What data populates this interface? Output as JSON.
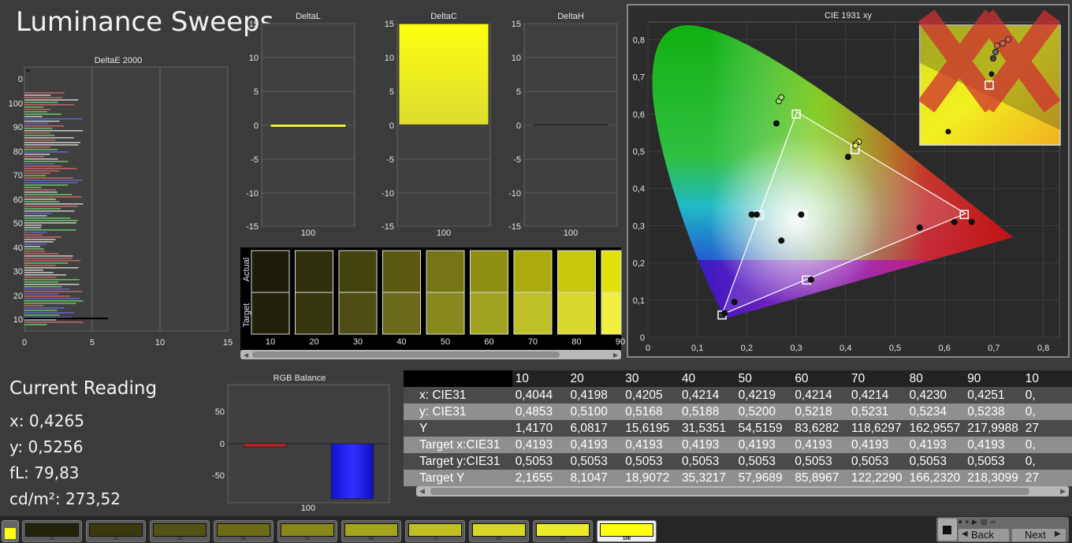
{
  "page_title": "Luminance Sweeps",
  "deltae_chart": {
    "title": "DeltaE 2000",
    "y_ticks": [
      "0",
      "100",
      "90",
      "80",
      "70",
      "60",
      "50",
      "40",
      "30",
      "20",
      "10"
    ],
    "x_ticks": [
      "0",
      "5",
      "10",
      "15"
    ]
  },
  "delta_charts": [
    {
      "title": "DeltaL",
      "category": "100",
      "y_ticks": [
        "15",
        "10",
        "5",
        "0",
        "-5",
        "-10",
        "-15"
      ]
    },
    {
      "title": "DeltaC",
      "category": "100",
      "y_ticks": [
        "15",
        "10",
        "5",
        "0",
        "-5",
        "-10",
        "-15"
      ]
    },
    {
      "title": "DeltaH",
      "category": "100",
      "y_ticks": [
        "15",
        "10",
        "5",
        "0",
        "-5",
        "-10",
        "-15"
      ]
    }
  ],
  "swatch_strip": {
    "actual_label": "Actual",
    "target_label": "Target",
    "labels": [
      "10",
      "20",
      "30",
      "40",
      "50",
      "60",
      "70",
      "80",
      "90"
    ]
  },
  "cie": {
    "title": "CIE 1931 xy",
    "x_ticks": [
      "0",
      "0,1",
      "0,2",
      "0,3",
      "0,4",
      "0,5",
      "0,6",
      "0,7",
      "0,8"
    ],
    "y_ticks": [
      "0,8",
      "0,7",
      "0,6",
      "0,5",
      "0,4",
      "0,3",
      "0,2",
      "0,1",
      "0"
    ]
  },
  "current_reading": {
    "heading": "Current Reading",
    "x": "x: 0,4265",
    "y": "y: 0,5256",
    "fl": "fL: 79,83",
    "cdm2": "cd/m²: 273,52"
  },
  "rgb_balance": {
    "title": "RGB Balance",
    "category": "100",
    "y_ticks": [
      "50",
      "0",
      "-50"
    ]
  },
  "table": {
    "columns": [
      "10",
      "20",
      "30",
      "40",
      "50",
      "60",
      "70",
      "80",
      "90",
      "10"
    ],
    "rows": [
      {
        "label": "x: CIE31",
        "values": [
          "0,4044",
          "0,4198",
          "0,4205",
          "0,4214",
          "0,4219",
          "0,4214",
          "0,4214",
          "0,4230",
          "0,4251",
          "0,"
        ]
      },
      {
        "label": "y: CIE31",
        "values": [
          "0,4853",
          "0,5100",
          "0,5168",
          "0,5188",
          "0,5200",
          "0,5218",
          "0,5231",
          "0,5234",
          "0,5238",
          "0,"
        ]
      },
      {
        "label": "Y",
        "values": [
          "1,4170",
          "6,0817",
          "15,6195",
          "31,5351",
          "54,5159",
          "83,6282",
          "118,6297",
          "162,9557",
          "217,9988",
          "27"
        ]
      },
      {
        "label": "Target x:CIE31",
        "values": [
          "0,4193",
          "0,4193",
          "0,4193",
          "0,4193",
          "0,4193",
          "0,4193",
          "0,4193",
          "0,4193",
          "0,4193",
          "0,"
        ]
      },
      {
        "label": "Target y:CIE31",
        "values": [
          "0,5053",
          "0,5053",
          "0,5053",
          "0,5053",
          "0,5053",
          "0,5053",
          "0,5053",
          "0,5053",
          "0,5053",
          "0,"
        ]
      },
      {
        "label": "Target Y",
        "values": [
          "2,1655",
          "8,1047",
          "18,9072",
          "35,3217",
          "57,9689",
          "85,8967",
          "122,2290",
          "166,2320",
          "218,3099",
          "27"
        ]
      }
    ]
  },
  "bottom_bar": {
    "swatches": [
      "10",
      "20",
      "30",
      "40",
      "50",
      "60",
      "70",
      "80",
      "90",
      "100"
    ],
    "selected": "100",
    "back_label": "Back",
    "next_label": "Next"
  },
  "chart_data": [
    {
      "type": "bar",
      "title": "DeltaL",
      "categories": [
        "100"
      ],
      "values": [
        -0.3
      ],
      "ylim": [
        -15,
        15
      ],
      "colors": {
        "bar": "#f2ef3a"
      }
    },
    {
      "type": "bar",
      "title": "DeltaC",
      "categories": [
        "100"
      ],
      "values": [
        15
      ],
      "ylim": [
        -15,
        15
      ],
      "colors": {
        "bar": "#ffff00"
      }
    },
    {
      "type": "bar",
      "title": "DeltaH",
      "categories": [
        "100"
      ],
      "values": [
        0
      ],
      "ylim": [
        -15,
        15
      ]
    },
    {
      "type": "bar",
      "title": "RGB Balance",
      "categories": [
        "100"
      ],
      "series": [
        {
          "values": [
            -3
          ]
        },
        {
          "values": [
            0
          ]
        },
        {
          "values": [
            -85
          ]
        }
      ],
      "series_colors": [
        "#d42020",
        "#20a020",
        "#1414f0"
      ],
      "ylim": [
        -85,
        85
      ]
    },
    {
      "type": "scatter",
      "title": "CIE 1931 xy",
      "xlim": [
        0,
        0.85
      ],
      "ylim": [
        0,
        0.85
      ],
      "gamut_targets": [
        [
          0.64,
          0.33
        ],
        [
          0.3,
          0.6
        ],
        [
          0.15,
          0.06
        ],
        [
          0.3127,
          0.329
        ],
        [
          0.225,
          0.329
        ],
        [
          0.321,
          0.154
        ],
        [
          0.419,
          0.505
        ]
      ],
      "measured": [
        [
          0.4265,
          0.5256
        ],
        [
          0.421,
          0.52
        ],
        [
          0.42,
          0.515
        ],
        [
          0.405,
          0.485
        ],
        [
          0.26,
          0.575
        ],
        [
          0.655,
          0.31
        ],
        [
          0.62,
          0.31
        ],
        [
          0.55,
          0.295
        ],
        [
          0.31,
          0.33
        ],
        [
          0.27,
          0.26
        ],
        [
          0.21,
          0.33
        ],
        [
          0.22,
          0.33
        ],
        [
          0.175,
          0.095
        ],
        [
          0.155,
          0.065
        ],
        [
          0.33,
          0.155
        ],
        [
          0.265,
          0.635
        ],
        [
          0.27,
          0.645
        ]
      ]
    }
  ]
}
